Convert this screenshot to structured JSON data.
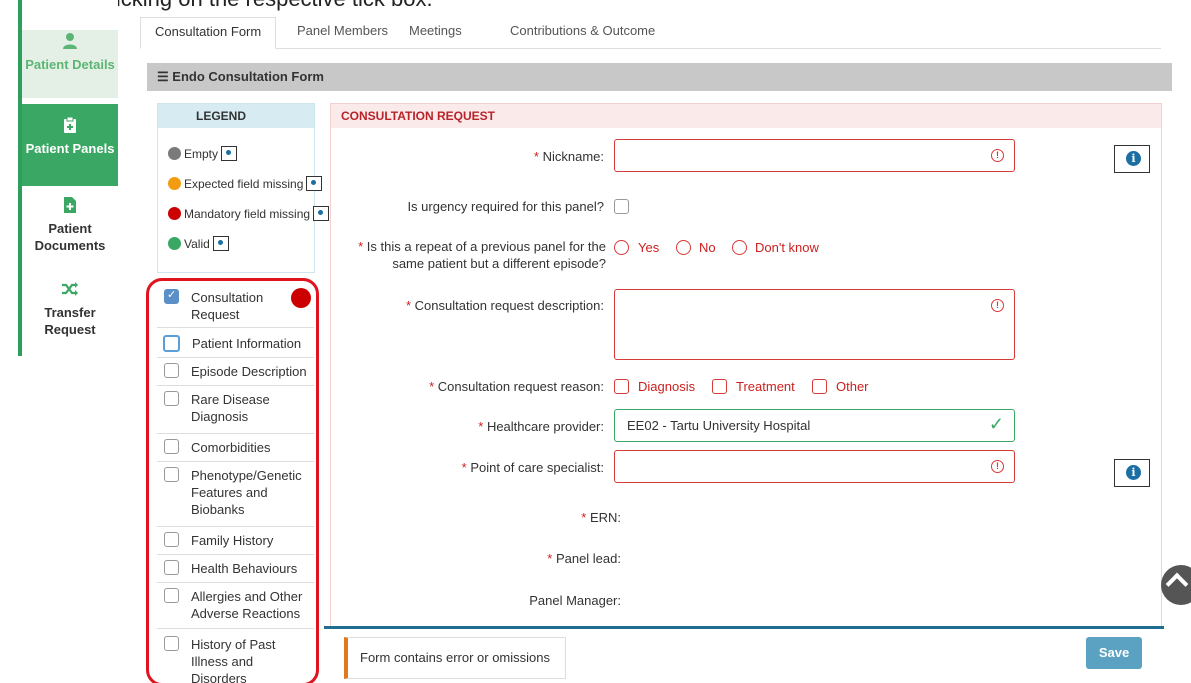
{
  "caption": "clicking on the respective tick box.",
  "sidebar": {
    "items": [
      {
        "label": "Patient Details",
        "icon": "patient-icon"
      },
      {
        "label": "Patient Panels",
        "icon": "clipboard-icon"
      },
      {
        "label": "Patient Documents",
        "icon": "document-add-icon"
      },
      {
        "label": "Transfer Request",
        "icon": "shuffle-icon"
      }
    ]
  },
  "tabs": [
    "Consultation Form",
    "Panel Members",
    "Meetings",
    "Contributions & Outcome"
  ],
  "form_header": {
    "icon": "list-icon",
    "title": "Endo Consultation Form"
  },
  "legend": {
    "title": "LEGEND",
    "items": [
      {
        "label": "Empty",
        "color": "#7a7a7a"
      },
      {
        "label": "Expected field missing",
        "color": "#f39c12"
      },
      {
        "label": "Mandatory field missing",
        "color": "#cc0000"
      },
      {
        "label": "Valid",
        "color": "#3aa864"
      }
    ]
  },
  "sections": [
    {
      "label": "Consultation Request",
      "checked": true
    },
    {
      "label": "Patient Information",
      "checked": false
    },
    {
      "label": "Episode Description",
      "checked": false
    },
    {
      "label": "Rare Disease Diagnosis",
      "checked": false
    },
    {
      "label": "Comorbidities",
      "checked": false
    },
    {
      "label": "Phenotype/Genetic Features and Biobanks",
      "checked": false
    },
    {
      "label": "Family History",
      "checked": false
    },
    {
      "label": "Health Behaviours",
      "checked": false
    },
    {
      "label": "Allergies and Other Adverse Reactions",
      "checked": false
    },
    {
      "label": "History of Past Illness and Disorders",
      "checked": false
    }
  ],
  "form": {
    "section_title": "CONSULTATION REQUEST",
    "required_marker": "*",
    "nickname_label": "Nickname:",
    "nickname_value": "",
    "urgency_label": "Is urgency required for this panel?",
    "repeat_label": "Is this a repeat of a previous panel for the same patient but a different episode?",
    "repeat_options": [
      "Yes",
      "No",
      "Don't know"
    ],
    "description_label": "Consultation request description:",
    "reason_label": "Consultation request reason:",
    "reason_options": [
      "Diagnosis",
      "Treatment",
      "Other"
    ],
    "provider_label": "Healthcare provider:",
    "provider_value": "EE02 - Tartu University Hospital",
    "specialist_label": "Point of care specialist:",
    "ern_label": "ERN:",
    "panel_lead_label": "Panel lead:",
    "panel_manager_label": "Panel Manager:"
  },
  "footer": {
    "message": "Form contains error or omissions",
    "save_label": "Save"
  }
}
